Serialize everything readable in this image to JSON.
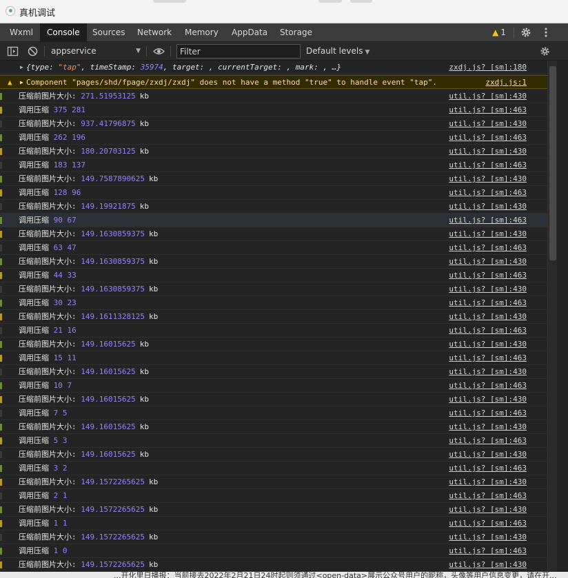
{
  "window": {
    "title": "真机调试"
  },
  "tabs": [
    "Wxml",
    "Console",
    "Sources",
    "Network",
    "Memory",
    "AppData",
    "Storage"
  ],
  "active_tab": "Console",
  "warning_count": "1",
  "toolbar": {
    "context": "appservice",
    "filter_placeholder": "Filter",
    "levels": "Default levels"
  },
  "console": {
    "object_row": {
      "parts": [
        {
          "t": "k",
          "v": "{type: "
        },
        {
          "t": "s",
          "v": "\"tap\""
        },
        {
          "t": "k",
          "v": ", timeStamp: "
        },
        {
          "t": "n",
          "v": "35974"
        },
        {
          "t": "k",
          "v": ", target: , currentTarget: , mark: , …}"
        }
      ],
      "source": "zxdj.js? [sm]:180"
    },
    "warning_row": {
      "text": "Component \"pages/shd/fpage/zxdj/zxdj\" does not have a method \"true\" to handle event \"tap\".",
      "source": "zxdj.js:1"
    },
    "log_rows": [
      {
        "label": "压缩前图片大小:",
        "value": "271.51953125",
        "unit": "kb",
        "source": "util.js? [sm]:430"
      },
      {
        "label": "调用压缩",
        "value": "375 281",
        "unit": "",
        "source": "util.js? [sm]:463"
      },
      {
        "label": "压缩前图片大小:",
        "value": "937.41796875",
        "unit": "kb",
        "source": "util.js? [sm]:430"
      },
      {
        "label": "调用压缩",
        "value": "262 196",
        "unit": "",
        "source": "util.js? [sm]:463"
      },
      {
        "label": "压缩前图片大小:",
        "value": "180.20703125",
        "unit": "kb",
        "source": "util.js? [sm]:430"
      },
      {
        "label": "调用压缩",
        "value": "183 137",
        "unit": "",
        "source": "util.js? [sm]:463"
      },
      {
        "label": "压缩前图片大小:",
        "value": "149.7587890625",
        "unit": "kb",
        "source": "util.js? [sm]:430"
      },
      {
        "label": "调用压缩",
        "value": "128 96",
        "unit": "",
        "source": "util.js? [sm]:463"
      },
      {
        "label": "压缩前图片大小:",
        "value": "149.19921875",
        "unit": "kb",
        "source": "util.js? [sm]:430"
      },
      {
        "label": "调用压缩",
        "value": "90 67",
        "unit": "",
        "source": "util.js? [sm]:463"
      },
      {
        "label": "压缩前图片大小:",
        "value": "149.1630859375",
        "unit": "kb",
        "source": "util.js? [sm]:430"
      },
      {
        "label": "调用压缩",
        "value": "63 47",
        "unit": "",
        "source": "util.js? [sm]:463"
      },
      {
        "label": "压缩前图片大小:",
        "value": "149.1630859375",
        "unit": "kb",
        "source": "util.js? [sm]:430"
      },
      {
        "label": "调用压缩",
        "value": "44 33",
        "unit": "",
        "source": "util.js? [sm]:463"
      },
      {
        "label": "压缩前图片大小:",
        "value": "149.1630859375",
        "unit": "kb",
        "source": "util.js? [sm]:430"
      },
      {
        "label": "调用压缩",
        "value": "30 23",
        "unit": "",
        "source": "util.js? [sm]:463"
      },
      {
        "label": "压缩前图片大小:",
        "value": "149.1611328125",
        "unit": "kb",
        "source": "util.js? [sm]:430"
      },
      {
        "label": "调用压缩",
        "value": "21 16",
        "unit": "",
        "source": "util.js? [sm]:463"
      },
      {
        "label": "压缩前图片大小:",
        "value": "149.16015625",
        "unit": "kb",
        "source": "util.js? [sm]:430"
      },
      {
        "label": "调用压缩",
        "value": "15 11",
        "unit": "",
        "source": "util.js? [sm]:463"
      },
      {
        "label": "压缩前图片大小:",
        "value": "149.16015625",
        "unit": "kb",
        "source": "util.js? [sm]:430"
      },
      {
        "label": "调用压缩",
        "value": "10 7",
        "unit": "",
        "source": "util.js? [sm]:463"
      },
      {
        "label": "压缩前图片大小:",
        "value": "149.16015625",
        "unit": "kb",
        "source": "util.js? [sm]:430"
      },
      {
        "label": "调用压缩",
        "value": "7 5",
        "unit": "",
        "source": "util.js? [sm]:463"
      },
      {
        "label": "压缩前图片大小:",
        "value": "149.16015625",
        "unit": "kb",
        "source": "util.js? [sm]:430"
      },
      {
        "label": "调用压缩",
        "value": "5 3",
        "unit": "",
        "source": "util.js? [sm]:463"
      },
      {
        "label": "压缩前图片大小:",
        "value": "149.16015625",
        "unit": "kb",
        "source": "util.js? [sm]:430"
      },
      {
        "label": "调用压缩",
        "value": "3 2",
        "unit": "",
        "source": "util.js? [sm]:463"
      },
      {
        "label": "压缩前图片大小:",
        "value": "149.1572265625",
        "unit": "kb",
        "source": "util.js? [sm]:430"
      },
      {
        "label": "调用压缩",
        "value": "2 1",
        "unit": "",
        "source": "util.js? [sm]:463"
      },
      {
        "label": "压缩前图片大小:",
        "value": "149.1572265625",
        "unit": "kb",
        "source": "util.js? [sm]:430"
      },
      {
        "label": "调用压缩",
        "value": "1 1",
        "unit": "",
        "source": "util.js? [sm]:463"
      },
      {
        "label": "压缩前图片大小:",
        "value": "149.1572265625",
        "unit": "kb",
        "source": "util.js? [sm]:430"
      },
      {
        "label": "调用压缩",
        "value": "1 0",
        "unit": "",
        "source": "util.js? [sm]:463"
      },
      {
        "label": "压缩前图片大小:",
        "value": "149.1572265625",
        "unit": "kb",
        "source": "util.js? [sm]:430"
      }
    ],
    "highlighted_row_index": 9
  },
  "bottom_notice": "...开化里日播报：当前接去2022年2月21日24时起则须通过<open-data>展示公众号用户的昵称，头像等用户信息变更，请在开..."
}
